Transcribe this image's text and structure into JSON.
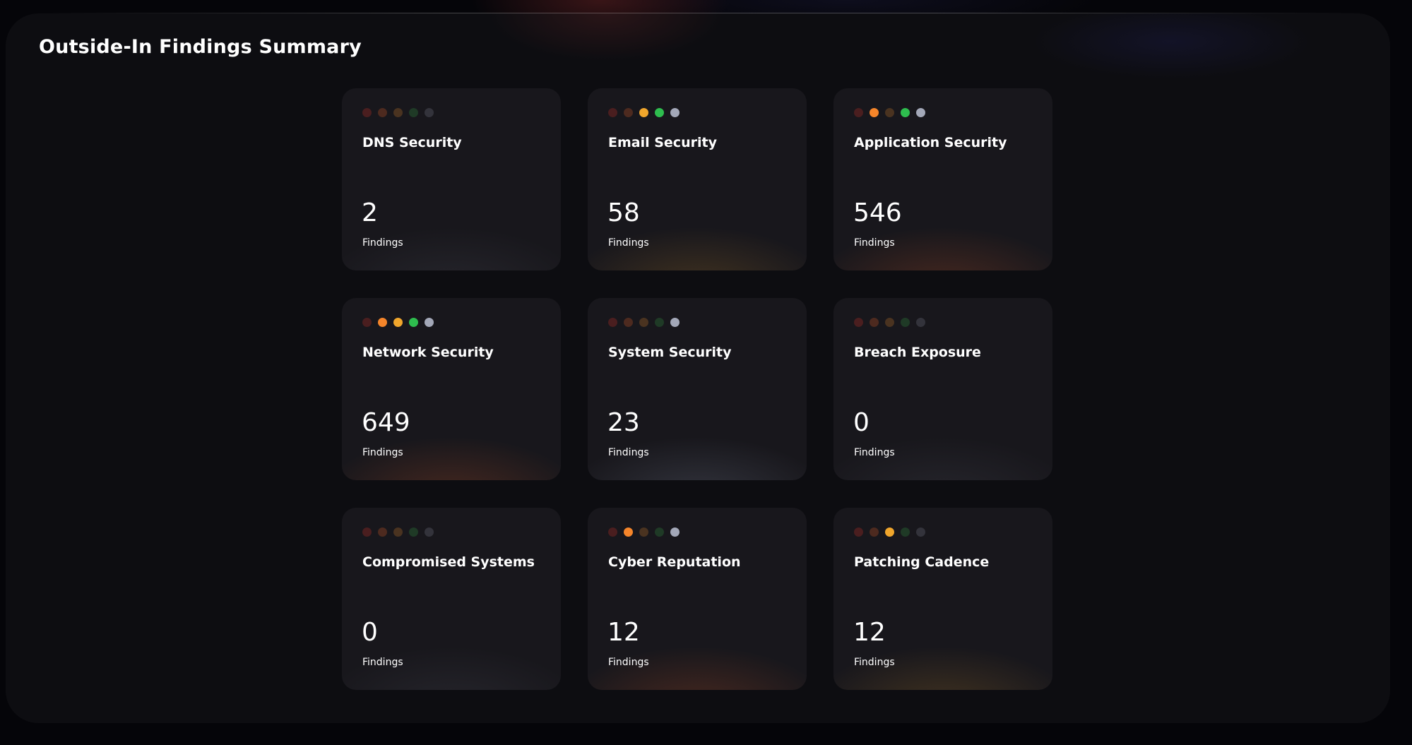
{
  "page": {
    "title": "Outside-In Findings Summary"
  },
  "colors": {
    "critical_on": "#e0413c",
    "critical_off": "#4a1e1f",
    "high_on": "#f5852a",
    "high_off": "#4d2a1f",
    "medium_on": "#f0a62c",
    "medium_off": "#4a3320",
    "low_on": "#2ebd4e",
    "low_off": "#1f3a26",
    "info_on": "#a3a8b8",
    "info_off": "#33333b"
  },
  "cards": [
    {
      "title": "DNS Security",
      "count": "2",
      "label": "Findings",
      "severity": [
        false,
        false,
        false,
        false,
        false
      ],
      "glow": "neutral"
    },
    {
      "title": "Email Security",
      "count": "58",
      "label": "Findings",
      "severity": [
        false,
        false,
        true,
        true,
        true
      ],
      "glow": "amber"
    },
    {
      "title": "Application Security",
      "count": "546",
      "label": "Findings",
      "severity": [
        false,
        true,
        false,
        true,
        true
      ],
      "glow": "orange"
    },
    {
      "title": "Network Security",
      "count": "649",
      "label": "Findings",
      "severity": [
        false,
        true,
        true,
        true,
        true
      ],
      "glow": "orange"
    },
    {
      "title": "System Security",
      "count": "23",
      "label": "Findings",
      "severity": [
        false,
        false,
        false,
        false,
        true
      ],
      "glow": "grey"
    },
    {
      "title": "Breach Exposure",
      "count": "0",
      "label": "Findings",
      "severity": [
        false,
        false,
        false,
        false,
        false
      ],
      "glow": "neutral"
    },
    {
      "title": "Compromised Systems",
      "count": "0",
      "label": "Findings",
      "severity": [
        false,
        false,
        false,
        false,
        false
      ],
      "glow": "neutral"
    },
    {
      "title": "Cyber Reputation",
      "count": "12",
      "label": "Findings",
      "severity": [
        false,
        true,
        false,
        false,
        true
      ],
      "glow": "orange"
    },
    {
      "title": "Patching Cadence",
      "count": "12",
      "label": "Findings",
      "severity": [
        false,
        false,
        true,
        false,
        false
      ],
      "glow": "amber"
    }
  ]
}
